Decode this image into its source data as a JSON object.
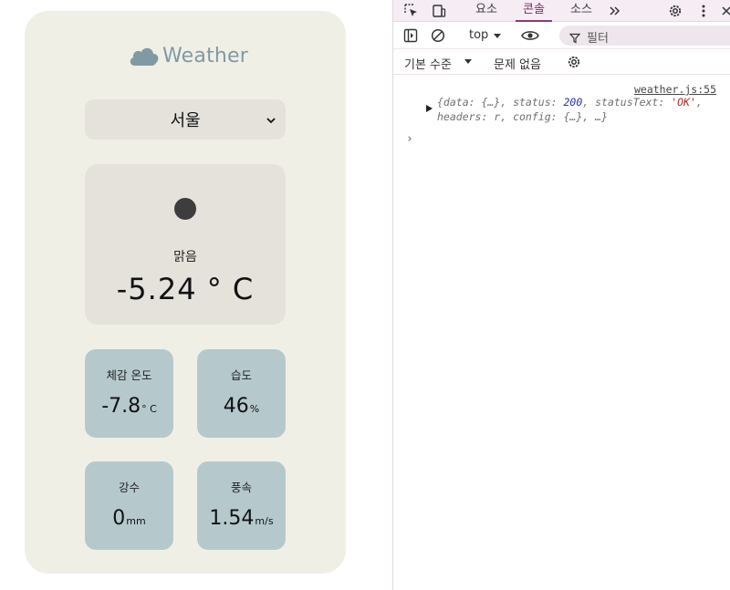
{
  "app": {
    "logo_text": "Weather",
    "city_select": {
      "value": "서울"
    },
    "main": {
      "description": "맑음",
      "temperature": "-5.24 ° C"
    },
    "metrics": {
      "feels_like": {
        "label": "체감 온도",
        "value": "-7.8",
        "unit": "° C"
      },
      "humidity": {
        "label": "습도",
        "value": "46",
        "unit": "%"
      },
      "precipitation": {
        "label": "강수",
        "value": "0",
        "unit": "mm"
      },
      "wind": {
        "label": "풍속",
        "value": "1.54",
        "unit": "m/s"
      }
    }
  },
  "devtools": {
    "tabs": [
      "요소",
      "콘솔",
      "소스"
    ],
    "active_tab": "콘솔",
    "context": "top",
    "filter_placeholder": "필터",
    "log_level": "기본 수준",
    "issues": "문제 없음",
    "log": {
      "source": "weather.js:55",
      "parts": {
        "p1": "{data: {…}, status: ",
        "status": "200",
        "p2": ", statusText: ",
        "status_text": "'OK'",
        "p3": ",",
        "line2": "headers: r, config: {…}, …}"
      }
    },
    "prompt": "›",
    "icons": [
      "inspect-icon",
      "device-toggle-icon",
      "more-tabs-icon",
      "settings-icon",
      "kebab-menu-icon",
      "close-icon",
      "sidebar-toggle-icon",
      "clear-console-icon",
      "dropdown-icon",
      "eye-icon",
      "filter-icon",
      "console-settings-icon"
    ]
  },
  "colors": {
    "card_bg": "#f0efe6",
    "tile_bg": "#e4e2db",
    "metric_bg": "#b5c9cd",
    "logo": "#7f9aa3",
    "devtools_tabbar": "#f5edf3",
    "accent": "#8a3a7a"
  }
}
